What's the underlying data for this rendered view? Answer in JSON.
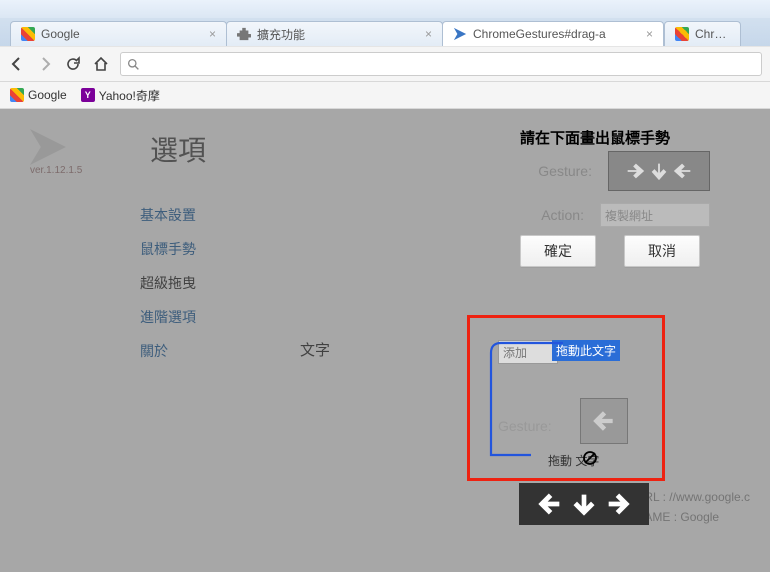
{
  "tabs": [
    {
      "title": "Google",
      "icon": "google"
    },
    {
      "title": "擴充功能",
      "icon": "extension"
    },
    {
      "title": "ChromeGestures#drag-a",
      "icon": "gesture",
      "active": true
    },
    {
      "title": "Chrom",
      "icon": "google"
    }
  ],
  "bookmarks": [
    {
      "label": "Google",
      "icon": "google"
    },
    {
      "label": "Yahoo!奇摩",
      "icon": "yahoo"
    }
  ],
  "omnibox": {
    "icon": "search"
  },
  "sidebar": {
    "title": "選項",
    "version": "ver.1.12.1.5",
    "items": [
      "基本設置",
      "鼠標手勢",
      "超級拖曳",
      "進階選項",
      "關於"
    ],
    "selected_index": 2
  },
  "section": {
    "label": "文字"
  },
  "dialog": {
    "title": "請在下面畫出鼠標手勢",
    "gesture_label": "Gesture:",
    "action_label": "Action:",
    "action_value": "複製網址",
    "ok": "確定",
    "cancel": "取消"
  },
  "dragbox": {
    "add_label": "添加",
    "drag_pill": "拖動此文字",
    "gesture_label": "Gesture:",
    "drag_text": "拖動    文字"
  },
  "bg": {
    "url_label": "URL",
    "url_value": "//www.google.c",
    "name_label": "NAME",
    "name_value": "Google"
  }
}
